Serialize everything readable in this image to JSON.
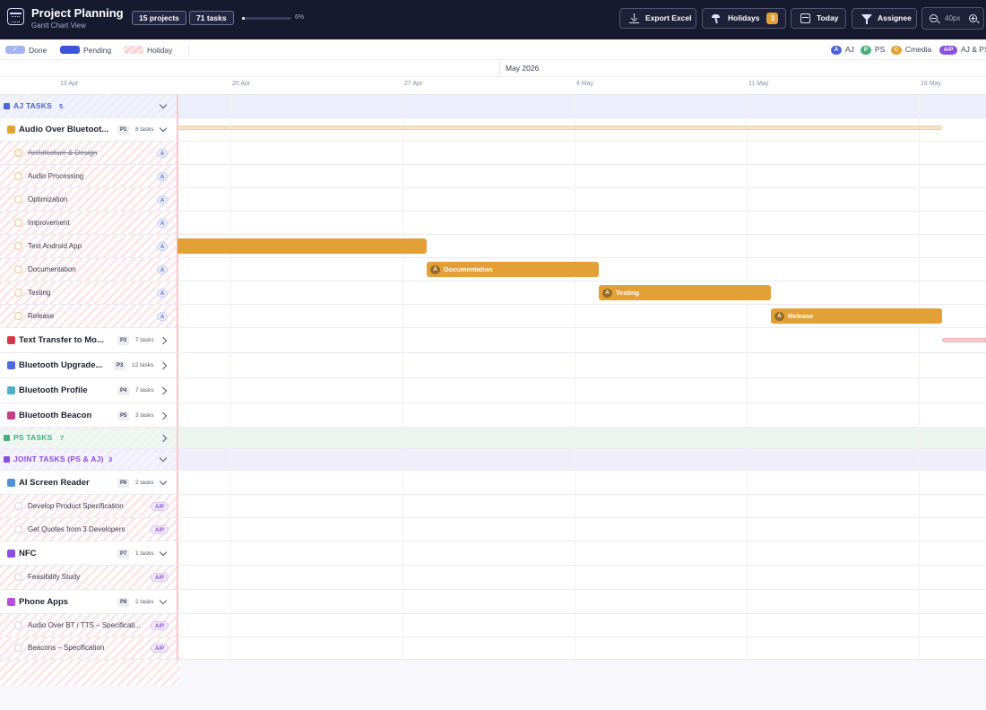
{
  "header": {
    "title": "Project Planning",
    "subtitle": "Gantt Chart View",
    "projects_pill": "15 projects",
    "tasks_pill": "71 tasks",
    "progress_percent": 6,
    "progress_label": "6%",
    "buttons": {
      "export": "Export Excel",
      "holidays": "Holidays",
      "holidays_count": "3",
      "today": "Today",
      "assignee": "Assignee"
    },
    "zoom_level": "40px"
  },
  "legend": {
    "status": [
      {
        "label": "Done",
        "check": "✓"
      },
      {
        "label": "Pending"
      },
      {
        "label": "Holiday"
      }
    ],
    "assignees": [
      {
        "badge": "A",
        "label": "AJ",
        "color": "#4f63d8"
      },
      {
        "badge": "P",
        "label": "PS",
        "color": "#46b07a"
      },
      {
        "badge": "C",
        "label": "Cmedia",
        "color": "#e3a136"
      },
      {
        "badge": "A/P",
        "label": "AJ & PS",
        "color": "#8b4fe0"
      }
    ]
  },
  "timeline": {
    "month": "May 2026",
    "weeks": [
      "13 Apr",
      "20 Apr",
      "27 Apr",
      "4 May",
      "11 May",
      "18 May"
    ]
  },
  "groups": {
    "aj": {
      "name": "AJ TASKS",
      "count": "5",
      "color": "#4f63d8"
    },
    "ps": {
      "name": "PS TASKS",
      "count": "7",
      "color": "#46b07a"
    },
    "joint": {
      "name": "JOINT TASKS (PS & AJ)",
      "count": "3",
      "color": "#8b4fe0"
    }
  },
  "projects": {
    "p1": {
      "name": "Audio Over Bluetoot...",
      "badge": "P1",
      "count": "8 tasks",
      "color": "#e3a136"
    },
    "p2": {
      "name": "Text Transfer to Mo...",
      "badge": "P2",
      "count": "7 tasks",
      "color": "#d23a4a"
    },
    "p3": {
      "name": "Bluetooth Upgrade...",
      "badge": "P3",
      "count": "12 tasks",
      "color": "#4f6be0"
    },
    "p4": {
      "name": "Bluetooth Profile",
      "badge": "P4",
      "count": "7 tasks",
      "color": "#4fb0c8"
    },
    "p5": {
      "name": "Bluetooth Beacon",
      "badge": "P5",
      "count": "3 tasks",
      "color": "#c83a8a"
    },
    "p6": {
      "name": "AI Screen Reader",
      "badge": "P6",
      "count": "2 tasks",
      "color": "#4f94d8"
    },
    "p7": {
      "name": "NFC",
      "badge": "P7",
      "count": "1 tasks",
      "color": "#8b4fe0"
    },
    "p8": {
      "name": "Phone Apps",
      "badge": "P8",
      "count": "2 tasks",
      "color": "#b84fd8"
    }
  },
  "tasks": {
    "t1": {
      "name": "Architecture & Design",
      "badge": "A"
    },
    "t2": {
      "name": "Audio Processing",
      "badge": "A"
    },
    "t3": {
      "name": "Optimization",
      "badge": "A"
    },
    "t4": {
      "name": "Improvement",
      "badge": "A"
    },
    "t5": {
      "name": "Test Android App",
      "badge": "A"
    },
    "t6": {
      "name": "Documentation",
      "badge": "A"
    },
    "t7": {
      "name": "Testing",
      "badge": "A"
    },
    "t8": {
      "name": "Release",
      "badge": "A"
    },
    "j1": {
      "name": "Develop Product Specification",
      "badge": "A/P"
    },
    "j2": {
      "name": "Get Quotes from 3 Developers",
      "badge": "A/P"
    },
    "j3": {
      "name": "Feasibility Study",
      "badge": "A/P"
    },
    "j4": {
      "name": "Audio Over BT / TTS – Specificati...",
      "badge": "A/P"
    },
    "j5": {
      "name": "Beacons – Specification",
      "badge": "A/P"
    }
  },
  "bars": {
    "documentation": {
      "label": "Documentation",
      "badge": "A"
    },
    "testing": {
      "label": "Testing",
      "badge": "A"
    },
    "release": {
      "label": "Release",
      "badge": "A"
    }
  }
}
